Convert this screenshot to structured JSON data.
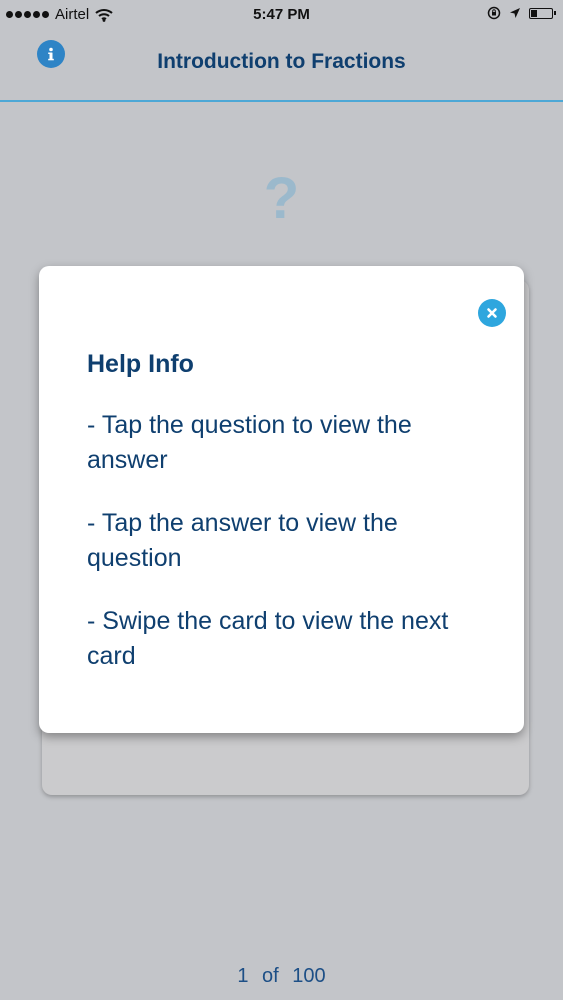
{
  "status_bar": {
    "carrier": "Airtel",
    "time": "5:47 PM",
    "battery_level": 0.3
  },
  "header": {
    "title": "Introduction to Fractions"
  },
  "card": {
    "question_symbol": "?"
  },
  "help_modal": {
    "title": "Help Info",
    "items": [
      "- Tap the question to view the answer",
      "- Tap the answer to view the question",
      "- Swipe the card to view the next card"
    ]
  },
  "pager": {
    "current": "1",
    "separator": "of",
    "total": "100"
  },
  "icons": {
    "info": "info-icon",
    "close": "close-icon",
    "wifi": "wifi-icon",
    "location": "location-arrow-icon",
    "orientation_lock": "orientation-lock-icon",
    "battery": "battery-icon"
  },
  "colors": {
    "accent": "#2ea6de",
    "title_text": "#0f3f6f",
    "background": "#c3c5c9"
  }
}
